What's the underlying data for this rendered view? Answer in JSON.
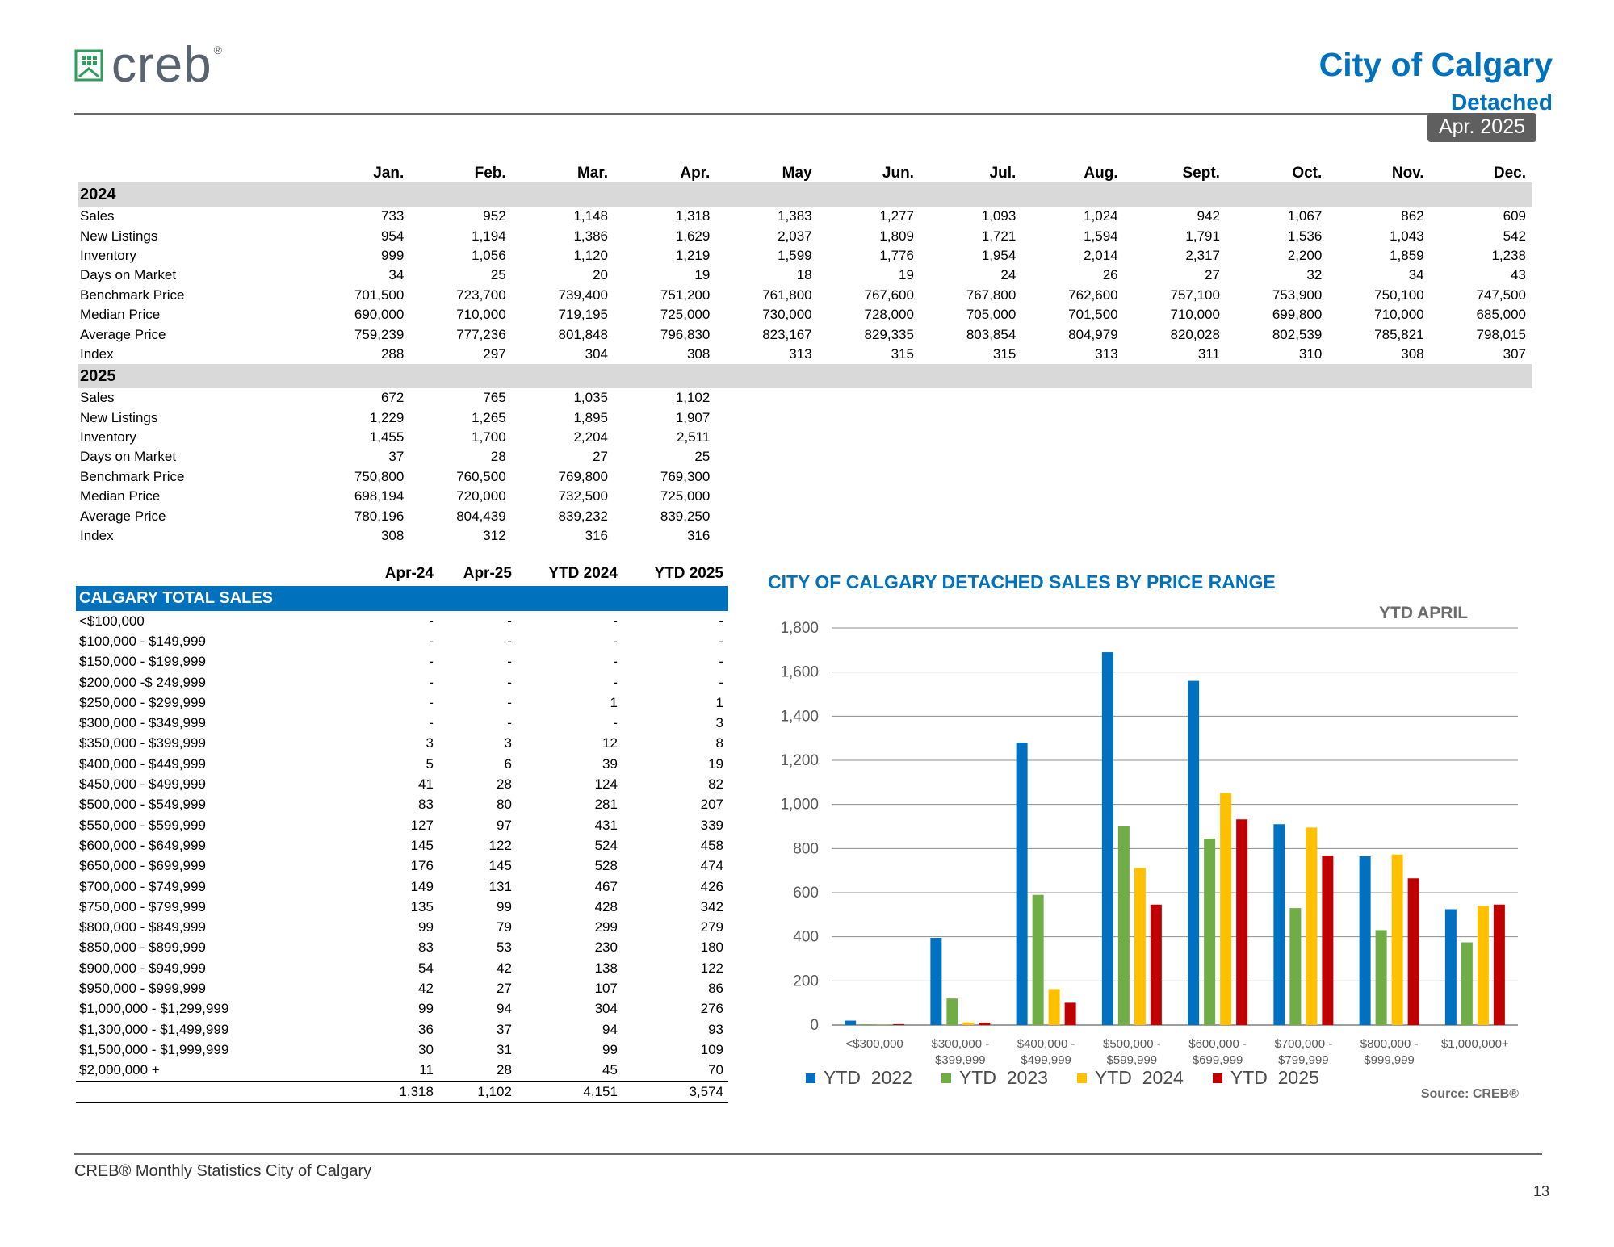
{
  "header": {
    "logo_text": "creb",
    "logo_reg": "®",
    "title": "City of Calgary",
    "subtitle": "Detached",
    "date_badge": "Apr. 2025"
  },
  "monthly": {
    "months": [
      "Jan.",
      "Feb.",
      "Mar.",
      "Apr.",
      "May",
      "Jun.",
      "Jul.",
      "Aug.",
      "Sept.",
      "Oct.",
      "Nov.",
      "Dec."
    ],
    "years": [
      {
        "year": "2024",
        "rows": [
          {
            "label": "Sales",
            "values": [
              "733",
              "952",
              "1,148",
              "1,318",
              "1,383",
              "1,277",
              "1,093",
              "1,024",
              "942",
              "1,067",
              "862",
              "609"
            ]
          },
          {
            "label": "New Listings",
            "values": [
              "954",
              "1,194",
              "1,386",
              "1,629",
              "2,037",
              "1,809",
              "1,721",
              "1,594",
              "1,791",
              "1,536",
              "1,043",
              "542"
            ]
          },
          {
            "label": "Inventory",
            "values": [
              "999",
              "1,056",
              "1,120",
              "1,219",
              "1,599",
              "1,776",
              "1,954",
              "2,014",
              "2,317",
              "2,200",
              "1,859",
              "1,238"
            ]
          },
          {
            "label": "Days on Market",
            "values": [
              "34",
              "25",
              "20",
              "19",
              "18",
              "19",
              "24",
              "26",
              "27",
              "32",
              "34",
              "43"
            ]
          },
          {
            "label": "Benchmark Price",
            "values": [
              "701,500",
              "723,700",
              "739,400",
              "751,200",
              "761,800",
              "767,600",
              "767,800",
              "762,600",
              "757,100",
              "753,900",
              "750,100",
              "747,500"
            ]
          },
          {
            "label": "Median Price",
            "values": [
              "690,000",
              "710,000",
              "719,195",
              "725,000",
              "730,000",
              "728,000",
              "705,000",
              "701,500",
              "710,000",
              "699,800",
              "710,000",
              "685,000"
            ]
          },
          {
            "label": "Average Price",
            "values": [
              "759,239",
              "777,236",
              "801,848",
              "796,830",
              "823,167",
              "829,335",
              "803,854",
              "804,979",
              "820,028",
              "802,539",
              "785,821",
              "798,015"
            ]
          },
          {
            "label": "Index",
            "values": [
              "288",
              "297",
              "304",
              "308",
              "313",
              "315",
              "315",
              "313",
              "311",
              "310",
              "308",
              "307"
            ]
          }
        ]
      },
      {
        "year": "2025",
        "rows": [
          {
            "label": "Sales",
            "values": [
              "672",
              "765",
              "1,035",
              "1,102"
            ]
          },
          {
            "label": "New Listings",
            "values": [
              "1,229",
              "1,265",
              "1,895",
              "1,907"
            ]
          },
          {
            "label": "Inventory",
            "values": [
              "1,455",
              "1,700",
              "2,204",
              "2,511"
            ]
          },
          {
            "label": "Days on Market",
            "values": [
              "37",
              "28",
              "27",
              "25"
            ]
          },
          {
            "label": "Benchmark Price",
            "values": [
              "750,800",
              "760,500",
              "769,800",
              "769,300"
            ]
          },
          {
            "label": "Median Price",
            "values": [
              "698,194",
              "720,000",
              "732,500",
              "725,000"
            ]
          },
          {
            "label": "Average Price",
            "values": [
              "780,196",
              "804,439",
              "839,232",
              "839,250"
            ]
          },
          {
            "label": "Index",
            "values": [
              "308",
              "312",
              "316",
              "316"
            ]
          }
        ]
      }
    ]
  },
  "price_table": {
    "columns": [
      "Apr-24",
      "Apr-25",
      "YTD 2024",
      "YTD 2025"
    ],
    "section_title": "CALGARY TOTAL SALES",
    "rows": [
      {
        "label": "<$100,000",
        "values": [
          "-",
          "-",
          "-",
          "-"
        ]
      },
      {
        "label": "$100,000 - $149,999",
        "values": [
          "-",
          "-",
          "-",
          "-"
        ]
      },
      {
        "label": "$150,000 - $199,999",
        "values": [
          "-",
          "-",
          "-",
          "-"
        ]
      },
      {
        "label": "$200,000 -$ 249,999",
        "values": [
          "-",
          "-",
          "-",
          "-"
        ]
      },
      {
        "label": "$250,000 - $299,999",
        "values": [
          "-",
          "-",
          "1",
          "1"
        ]
      },
      {
        "label": "$300,000 - $349,999",
        "values": [
          "-",
          "-",
          "-",
          "3"
        ]
      },
      {
        "label": "$350,000 - $399,999",
        "values": [
          "3",
          "3",
          "12",
          "8"
        ]
      },
      {
        "label": "$400,000 - $449,999",
        "values": [
          "5",
          "6",
          "39",
          "19"
        ]
      },
      {
        "label": "$450,000 - $499,999",
        "values": [
          "41",
          "28",
          "124",
          "82"
        ]
      },
      {
        "label": "$500,000 - $549,999",
        "values": [
          "83",
          "80",
          "281",
          "207"
        ]
      },
      {
        "label": "$550,000 - $599,999",
        "values": [
          "127",
          "97",
          "431",
          "339"
        ]
      },
      {
        "label": "$600,000 - $649,999",
        "values": [
          "145",
          "122",
          "524",
          "458"
        ]
      },
      {
        "label": "$650,000 - $699,999",
        "values": [
          "176",
          "145",
          "528",
          "474"
        ]
      },
      {
        "label": "$700,000 - $749,999",
        "values": [
          "149",
          "131",
          "467",
          "426"
        ]
      },
      {
        "label": "$750,000 - $799,999",
        "values": [
          "135",
          "99",
          "428",
          "342"
        ]
      },
      {
        "label": "$800,000 - $849,999",
        "values": [
          "99",
          "79",
          "299",
          "279"
        ]
      },
      {
        "label": "$850,000 - $899,999",
        "values": [
          "83",
          "53",
          "230",
          "180"
        ]
      },
      {
        "label": "$900,000 - $949,999",
        "values": [
          "54",
          "42",
          "138",
          "122"
        ]
      },
      {
        "label": "$950,000 - $999,999",
        "values": [
          "42",
          "27",
          "107",
          "86"
        ]
      },
      {
        "label": "$1,000,000 - $1,299,999",
        "values": [
          "99",
          "94",
          "304",
          "276"
        ]
      },
      {
        "label": "$1,300,000 - $1,499,999",
        "values": [
          "36",
          "37",
          "94",
          "93"
        ]
      },
      {
        "label": "$1,500,000 - $1,999,999",
        "values": [
          "30",
          "31",
          "99",
          "109"
        ]
      },
      {
        "label": "$2,000,000 +",
        "values": [
          "11",
          "28",
          "45",
          "70"
        ]
      }
    ],
    "totals": [
      "1,318",
      "1,102",
      "4,151",
      "3,574"
    ]
  },
  "chart_data": {
    "type": "bar",
    "title": "CITY OF CALGARY DETACHED SALES BY PRICE RANGE",
    "subtitle": "YTD  APRIL",
    "categories": [
      "<$300,000",
      "$300,000 - $399,999",
      "$400,000 - $499,999",
      "$500,000 - $599,999",
      "$600,000 - $699,999",
      "$700,000 - $799,999",
      "$800,000 - $999,999",
      "$1,000,000+"
    ],
    "category_lines": [
      [
        "<$300,000"
      ],
      [
        "$300,000 -",
        "$399,999"
      ],
      [
        "$400,000 -",
        "$499,999"
      ],
      [
        "$500,000 -",
        "$599,999"
      ],
      [
        "$600,000 -",
        "$699,999"
      ],
      [
        "$700,000 -",
        "$799,999"
      ],
      [
        "$800,000 -",
        "$999,999"
      ],
      [
        "$1,000,000+"
      ]
    ],
    "series": [
      {
        "name": "YTD  2022",
        "color": "#0070c0",
        "values": [
          20,
          395,
          1280,
          1690,
          1560,
          910,
          765,
          525
        ]
      },
      {
        "name": "YTD  2023",
        "color": "#70ad47",
        "values": [
          3,
          120,
          590,
          900,
          845,
          530,
          430,
          375
        ]
      },
      {
        "name": "YTD  2024",
        "color": "#ffc000",
        "values": [
          1,
          12,
          163,
          712,
          1052,
          895,
          773,
          540
        ]
      },
      {
        "name": "YTD  2025",
        "color": "#c00000",
        "values": [
          4,
          11,
          101,
          546,
          932,
          768,
          665,
          546
        ]
      }
    ],
    "ylim": [
      0,
      1800
    ],
    "yticks": [
      0,
      200,
      400,
      600,
      800,
      1000,
      1200,
      1400,
      1600,
      1800
    ],
    "ytick_labels": [
      "0",
      "200",
      "400",
      "600",
      "800",
      "1,000",
      "1,200",
      "1,400",
      "1,600",
      "1,800"
    ],
    "grid": true,
    "legend": "bottom",
    "source": "Source: CREB®"
  },
  "footer": {
    "text": "CREB® Monthly Statistics City of Calgary",
    "page": "13"
  }
}
